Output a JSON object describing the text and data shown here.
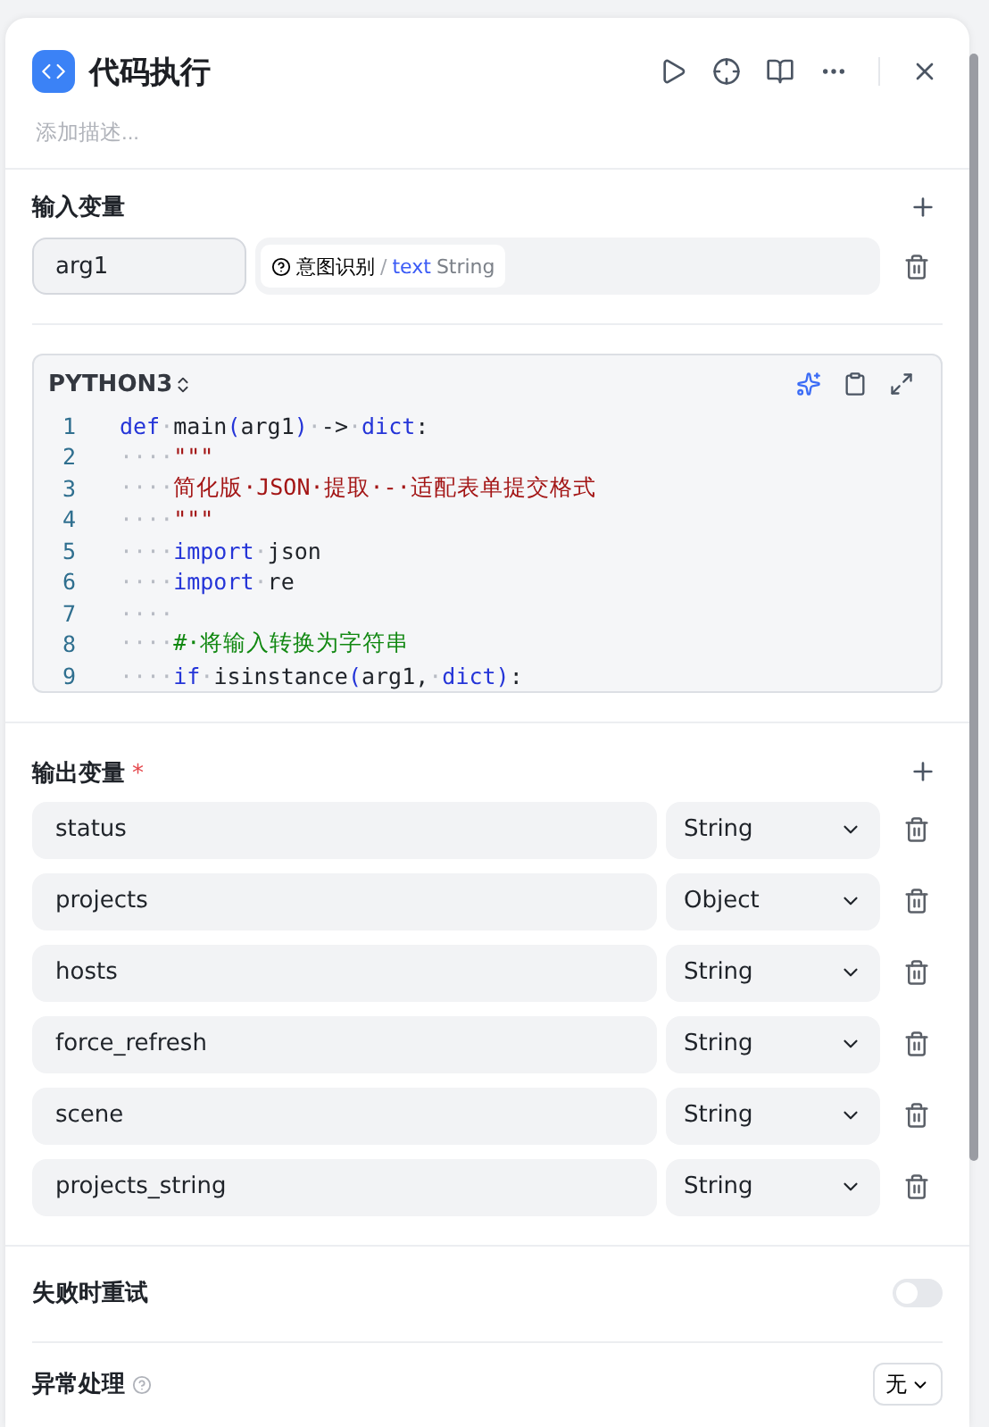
{
  "header": {
    "title": "代码执行",
    "description_placeholder": "添加描述..."
  },
  "input_section": {
    "title": "输入变量",
    "variables": [
      {
        "name": "arg1",
        "source_node": "意图识别",
        "separator": "/",
        "field": "text",
        "type": "String"
      }
    ]
  },
  "code_editor": {
    "language": "PYTHON3",
    "lines": [
      {
        "number": "1",
        "tokens": [
          {
            "kind": "kw",
            "text": "def"
          },
          {
            "kind": "ws",
            "text": "·"
          },
          {
            "kind": "plain",
            "text": "main"
          },
          {
            "kind": "kw",
            "text": "("
          },
          {
            "kind": "plain",
            "text": "arg1"
          },
          {
            "kind": "kw",
            "text": ")"
          },
          {
            "kind": "ws",
            "text": "·"
          },
          {
            "kind": "plain",
            "text": "->"
          },
          {
            "kind": "ws",
            "text": "·"
          },
          {
            "kind": "kw",
            "text": "dict"
          },
          {
            "kind": "plain",
            "text": ":"
          }
        ]
      },
      {
        "number": "2",
        "tokens": [
          {
            "kind": "ws",
            "text": "····"
          },
          {
            "kind": "str",
            "text": "\"\"\""
          }
        ]
      },
      {
        "number": "3",
        "tokens": [
          {
            "kind": "ws",
            "text": "····"
          },
          {
            "kind": "str",
            "text": "简化版·JSON·提取·-·适配表单提交格式"
          }
        ]
      },
      {
        "number": "4",
        "tokens": [
          {
            "kind": "ws",
            "text": "····"
          },
          {
            "kind": "str",
            "text": "\"\"\""
          }
        ]
      },
      {
        "number": "5",
        "tokens": [
          {
            "kind": "ws",
            "text": "····"
          },
          {
            "kind": "kw",
            "text": "import"
          },
          {
            "kind": "ws",
            "text": "·"
          },
          {
            "kind": "plain",
            "text": "json"
          }
        ]
      },
      {
        "number": "6",
        "tokens": [
          {
            "kind": "ws",
            "text": "····"
          },
          {
            "kind": "kw",
            "text": "import"
          },
          {
            "kind": "ws",
            "text": "·"
          },
          {
            "kind": "plain",
            "text": "re"
          }
        ]
      },
      {
        "number": "7",
        "tokens": [
          {
            "kind": "ws",
            "text": "····"
          }
        ]
      },
      {
        "number": "8",
        "tokens": [
          {
            "kind": "ws",
            "text": "····"
          },
          {
            "kind": "comment",
            "text": "#·将输入转换为字符串"
          }
        ]
      },
      {
        "number": "9",
        "tokens": [
          {
            "kind": "ws",
            "text": "····"
          },
          {
            "kind": "kw",
            "text": "if"
          },
          {
            "kind": "ws",
            "text": "·"
          },
          {
            "kind": "plain",
            "text": "isinstance"
          },
          {
            "kind": "kw",
            "text": "("
          },
          {
            "kind": "plain",
            "text": "arg1,"
          },
          {
            "kind": "ws",
            "text": "·"
          },
          {
            "kind": "kw",
            "text": "dict"
          },
          {
            "kind": "kw",
            "text": ")"
          },
          {
            "kind": "plain",
            "text": ":"
          }
        ]
      }
    ]
  },
  "output_section": {
    "title": "输出变量",
    "required_mark": "*",
    "variables": [
      {
        "name": "status",
        "type": "String"
      },
      {
        "name": "projects",
        "type": "Object"
      },
      {
        "name": "hosts",
        "type": "String"
      },
      {
        "name": "force_refresh",
        "type": "String"
      },
      {
        "name": "scene",
        "type": "String"
      },
      {
        "name": "projects_string",
        "type": "String"
      }
    ]
  },
  "retry": {
    "label": "失败时重试",
    "on": false
  },
  "exception": {
    "label": "异常处理",
    "value": "无"
  }
}
